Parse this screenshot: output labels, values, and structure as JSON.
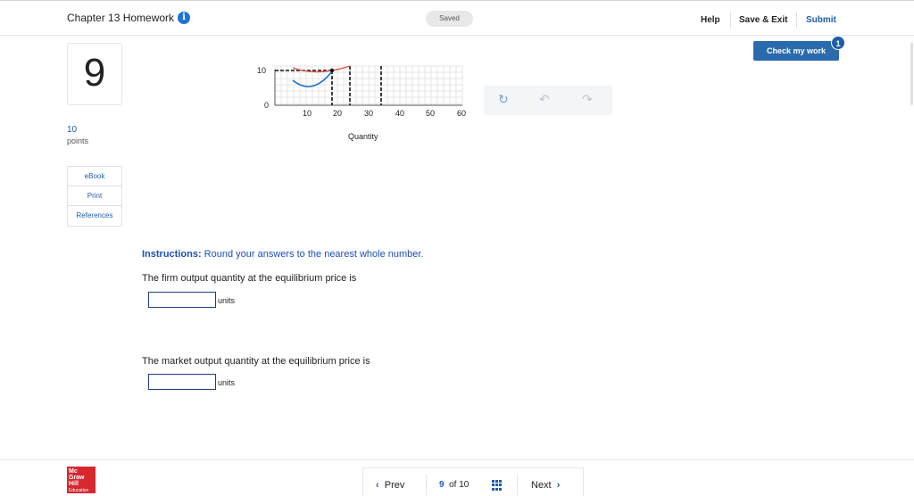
{
  "header": {
    "title": "Chapter 13 Homework",
    "saved": "Saved",
    "help": "Help",
    "save_exit": "Save & Exit",
    "submit": "Submit"
  },
  "check": {
    "label": "Check my work",
    "badge": "1"
  },
  "question": {
    "number": "9",
    "points_value": "10",
    "points_label": "points"
  },
  "side_links": [
    "eBook",
    "Print",
    "References"
  ],
  "graph": {
    "y_ticks": [
      "10",
      "0"
    ],
    "x_ticks": [
      "10",
      "20",
      "30",
      "40",
      "50",
      "60"
    ],
    "x_title": "Quantity"
  },
  "tools": {
    "reset": "reset-icon",
    "undo": "undo-icon",
    "redo": "redo-icon"
  },
  "instructions": {
    "bold": "Instructions:",
    "text": " Round your answers to the nearest whole number."
  },
  "q1": {
    "text": "The firm output quantity at the equilibrium price is",
    "unit": "units",
    "value": ""
  },
  "q2": {
    "text": "The market output quantity at the equilibrium price is",
    "unit": "units",
    "value": ""
  },
  "footer": {
    "logo_lines": [
      "Mc",
      "Graw",
      "Hill"
    ],
    "logo_small": "Education",
    "prev": "Prev",
    "current": "9",
    "of_total": "of 10",
    "next": "Next"
  },
  "colors": {
    "accent": "#1d5ea8",
    "logo_red": "#d7282f",
    "blue_curve": "#1d6fd0",
    "red_curve": "#d9574a"
  }
}
